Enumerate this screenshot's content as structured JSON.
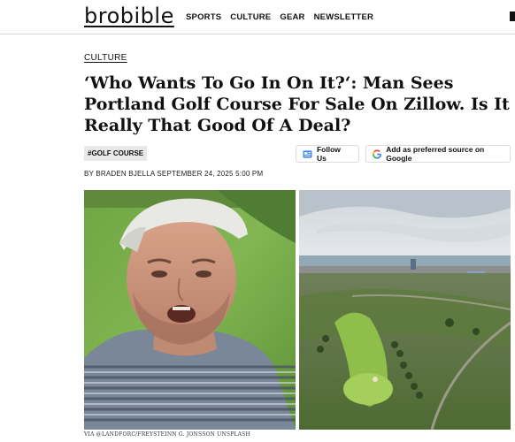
{
  "site": {
    "logo": "brobible",
    "nav": [
      "SPORTS",
      "CULTURE",
      "GEAR",
      "NEWSLETTER"
    ]
  },
  "article": {
    "category": "CULTURE",
    "headline": "‘Who Wants To Go In On It?‘: Man Sees Portland Golf Course For Sale On Zillow. Is It Really That Good Of A Deal?",
    "tag": "#GOLF COURSE",
    "follow_label": "Follow Us",
    "preferred_label": "Add as preferred source on Google",
    "byline": "BY BRADEN BJELLA SEPTEMBER 24, 2025 5:00 PM",
    "image_credit": "VIA @LANDFORC/FREYSTEINN G. JONSSON UNSPLASH"
  },
  "colors": {
    "text": "#111111",
    "tag_bg": "#e9e9e9",
    "divider": "#d9d9d9",
    "google_blue": "#4285f4",
    "google_red": "#ea4335",
    "google_yellow": "#fbbc05",
    "google_green": "#34a853"
  },
  "icons": [
    "news-icon",
    "google-g-icon"
  ]
}
